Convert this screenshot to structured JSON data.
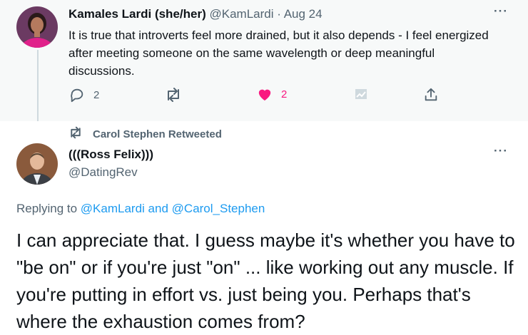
{
  "tweet1": {
    "display_name": "Kamales Lardi (she/her)",
    "handle": "@KamLardi",
    "separator": "·",
    "date": "Aug 24",
    "more_icon": "more-icon",
    "text": "It is true that introverts feel more drained, but it also depends - I feel energized after meeting someone on the same wavelength or deep meaningful discussions.",
    "reply_count": "2",
    "retweet_count": "",
    "like_count": "2",
    "liked": true,
    "like_color": "#f91880"
  },
  "retweet_banner": {
    "text": "Carol Stephen Retweeted"
  },
  "tweet2": {
    "display_name": "(((Ross Felix)))",
    "handle": "@DatingRev",
    "replying_prefix": "Replying to",
    "replying_user1": "@KamLardi",
    "replying_and": "and",
    "replying_user2": "@Carol_Stephen",
    "text": "I can appreciate that. I guess maybe it's whether you have to \"be on\" or if you're just \"on\" ... like working out any muscle. If you're putting in effort vs. just being you. Perhaps that's where the exhaustion comes from?"
  },
  "colors": {
    "accent": "#1d9bf0",
    "secondary_text": "#536471",
    "primary_text": "#0f1419",
    "highlight_bg": "#f7f9f9"
  }
}
